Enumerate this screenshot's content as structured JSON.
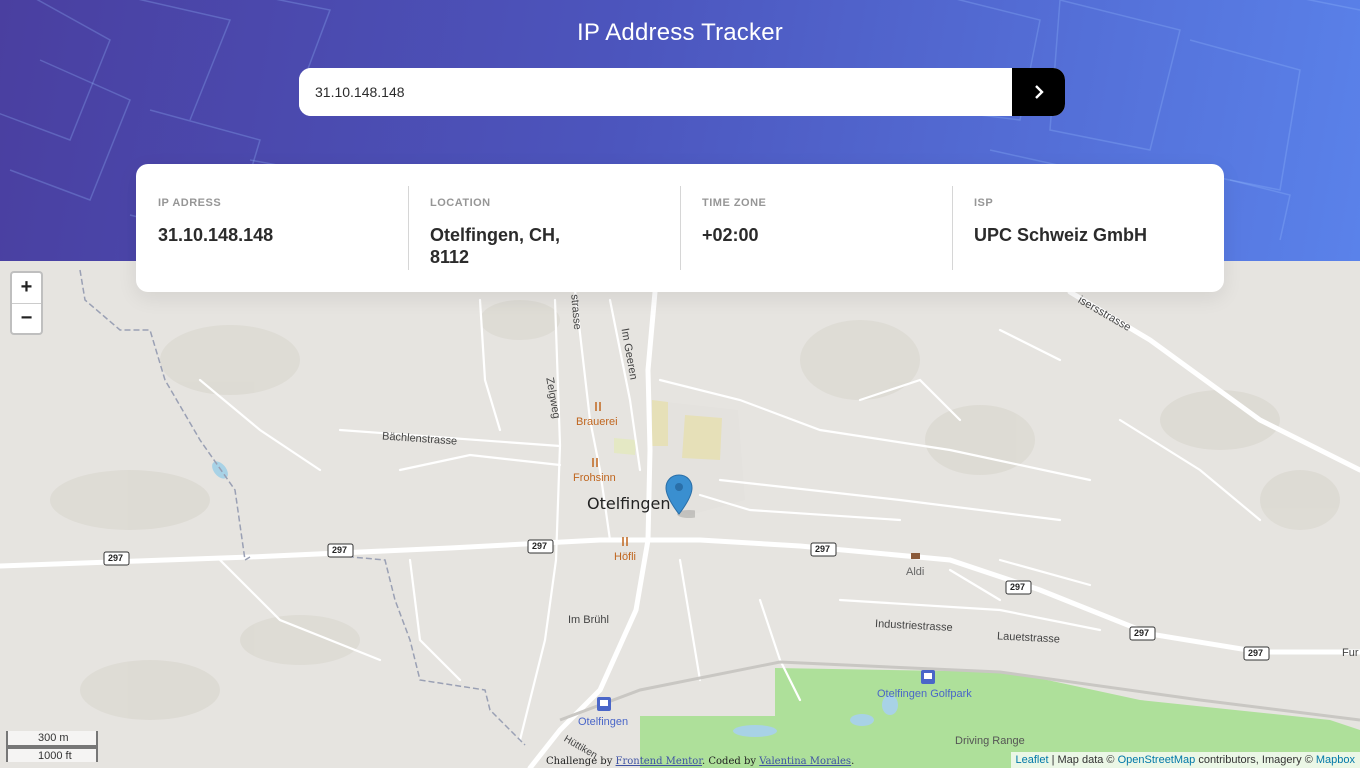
{
  "header": {
    "title": "IP Address Tracker",
    "search_value": "31.10.148.148",
    "submit_icon": "chevron-right-icon"
  },
  "info": {
    "ip": {
      "label": "IP ADRESS",
      "value": "31.10.148.148"
    },
    "location": {
      "label": "LOCATION",
      "value": "Otelfingen, CH, 8112"
    },
    "timezone": {
      "label": "TIME ZONE",
      "value": "+02:00"
    },
    "isp": {
      "label": "ISP",
      "value": "UPC Schweiz GmbH"
    }
  },
  "map": {
    "zoom_in": "+",
    "zoom_out": "−",
    "scale_metric": "300 m",
    "scale_imperial": "1000 ft",
    "labels": {
      "town": "Otelfingen",
      "brauerei": "Brauerei",
      "frohsinn": "Frohsinn",
      "hofli": "Höfli",
      "aldi": "Aldi",
      "bachlenstrasse": "Bächlenstrasse",
      "zelgweg": "Zelgweg",
      "im_geeren": "Im Geeren",
      "strasse_top": "strasse",
      "isersstrasse": "isersstrasse",
      "im_bruhl": "Im Brühl",
      "industriestrasse": "Industriestrasse",
      "lauetstrasse": "Lauetstrasse",
      "station": "Otelfingen",
      "golfpark": "Otelfingen Golfpark",
      "driving_range": "Driving Range",
      "huttiken": "Hüttiken",
      "fur": "Fur",
      "route": "297"
    },
    "marker_icon": "map-pin-icon"
  },
  "attribution": {
    "leaflet": "Leaflet",
    "text1": " | Map data © ",
    "osm": "OpenStreetMap",
    "text2": " contributors, Imagery © ",
    "mapbox": "Mapbox"
  },
  "credit": {
    "prefix": "Challenge by ",
    "frontend_mentor": "Frontend Mentor",
    "middle": ". Coded by ",
    "author": "Valentina Morales",
    "suffix": "."
  },
  "colors": {
    "accent": "#000000",
    "header_start": "#4a3fa0",
    "header_end": "#5a82ea",
    "marker": "#3a8fd0",
    "poi_orange": "#c0661f",
    "station_blue": "#4a66c8"
  }
}
